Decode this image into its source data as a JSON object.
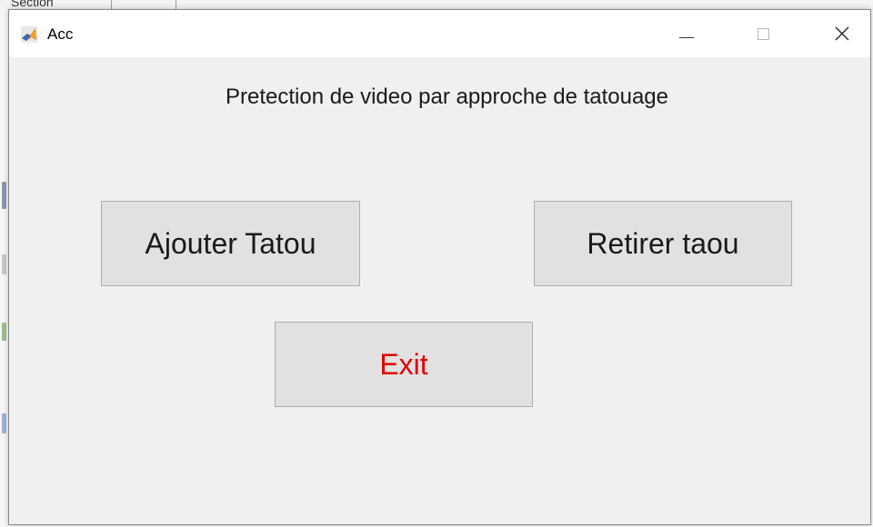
{
  "background_window": {
    "partial_text": "Section"
  },
  "window": {
    "title": "Acc",
    "app_icon": "matlab-icon",
    "controls": {
      "minimize_icon": "minimize-icon",
      "maximize_icon": "maximize-icon",
      "close_icon": "close-icon"
    }
  },
  "main": {
    "heading": "Pretection de video par approche de tatouage",
    "buttons": {
      "ajouter": "Ajouter Tatou",
      "retirer": "Retirer taou",
      "exit": "Exit"
    }
  },
  "colors": {
    "window_bg": "#f0f0f0",
    "button_bg": "#e1e1e1",
    "exit_text": "#e00000"
  }
}
